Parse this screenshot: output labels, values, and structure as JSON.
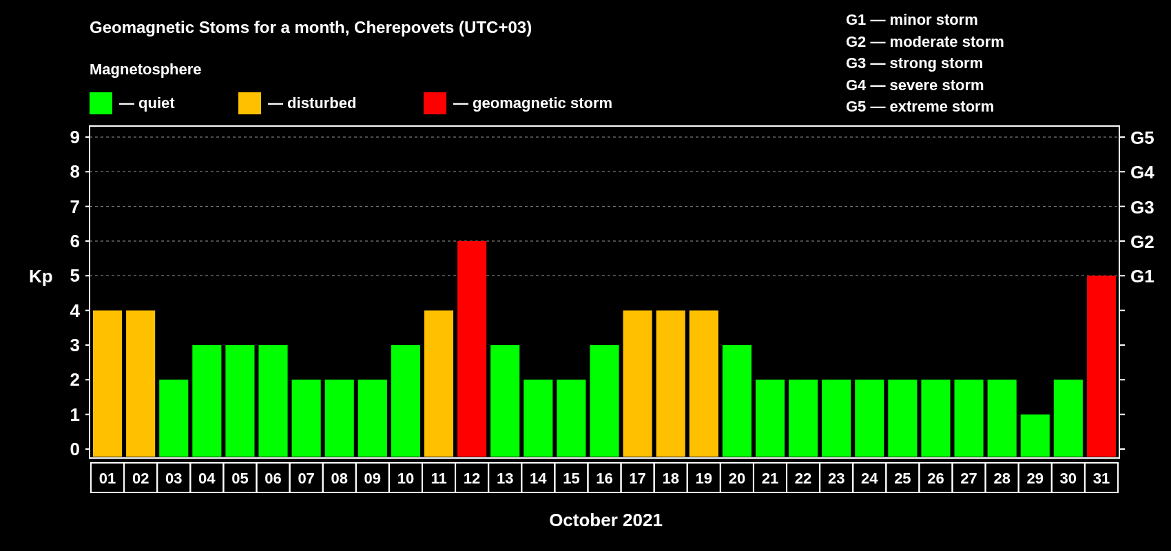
{
  "chart": {
    "legend_title": "Magnetosphere",
    "storm_scale": [
      "G1 — minor storm",
      "G2 — moderate storm",
      "G3 — strong storm",
      "G4 — severe storm",
      "G5 — extreme storm"
    ],
    "g_axis": [
      "G5",
      "G4",
      "G3",
      "G2",
      "G1"
    ],
    "chart_data": {
      "type": "bar",
      "title": "Geomagnetic Stoms for a month, Cherepovets (UTC+03)",
      "xlabel": "October 2021",
      "ylabel": "Kp",
      "categories": [
        "01",
        "02",
        "03",
        "04",
        "05",
        "06",
        "07",
        "08",
        "09",
        "10",
        "11",
        "12",
        "13",
        "14",
        "15",
        "16",
        "17",
        "18",
        "19",
        "20",
        "21",
        "22",
        "23",
        "24",
        "25",
        "26",
        "27",
        "28",
        "29",
        "30",
        "31"
      ],
      "series": [
        {
          "name": "— quiet",
          "color": "#00ff00",
          "values": [
            null,
            null,
            2,
            3,
            3,
            3,
            2,
            2,
            2,
            3,
            null,
            null,
            3,
            2,
            2,
            3,
            null,
            null,
            null,
            3,
            2,
            2,
            2,
            2,
            2,
            2,
            2,
            2,
            1,
            2,
            null
          ]
        },
        {
          "name": "— disturbed",
          "color": "#ffc000",
          "values": [
            4,
            4,
            null,
            null,
            null,
            null,
            null,
            null,
            null,
            null,
            4,
            null,
            null,
            null,
            null,
            null,
            4,
            4,
            4,
            null,
            null,
            null,
            null,
            null,
            null,
            null,
            null,
            null,
            null,
            null,
            null
          ]
        },
        {
          "name": "— geomagnetic storm",
          "color": "#ff0000",
          "values": [
            null,
            null,
            null,
            null,
            null,
            null,
            null,
            null,
            null,
            null,
            null,
            6,
            null,
            null,
            null,
            null,
            null,
            null,
            null,
            null,
            null,
            null,
            null,
            null,
            null,
            null,
            null,
            null,
            null,
            null,
            5
          ]
        }
      ],
      "ylim": [
        0,
        9
      ],
      "yticks": [
        0,
        1,
        2,
        3,
        4,
        5,
        6,
        7,
        8,
        9
      ],
      "grid": true,
      "legend": true
    }
  }
}
